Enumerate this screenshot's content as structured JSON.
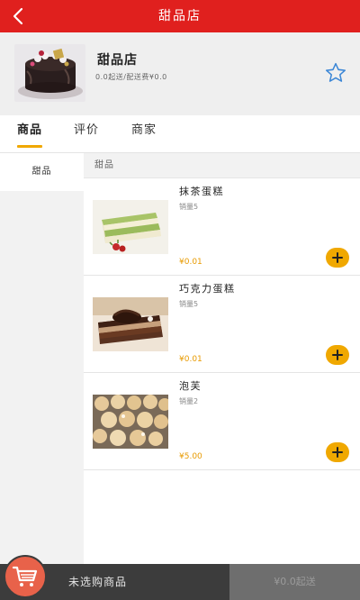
{
  "header": {
    "title": "甜品店"
  },
  "shop": {
    "name": "甜品店",
    "meta": "0.0起送/配送费¥0.0"
  },
  "tabs": [
    {
      "label": "商品"
    },
    {
      "label": "评价"
    },
    {
      "label": "商家"
    }
  ],
  "categories": [
    {
      "label": "甜品"
    }
  ],
  "list": {
    "section_title": "甜品",
    "items": [
      {
        "name": "抹茶蛋糕",
        "sales": "销量5",
        "price": "¥0.01"
      },
      {
        "name": "巧克力蛋糕",
        "sales": "销量5",
        "price": "¥0.01"
      },
      {
        "name": "泡芙",
        "sales": "销量2",
        "price": "¥5.00"
      }
    ]
  },
  "cart": {
    "empty_text": "未选购商品",
    "min_order": "¥0.0起送"
  },
  "colors": {
    "primary": "#e0201e",
    "accent": "#f0a800",
    "cart": "#e8624a"
  }
}
